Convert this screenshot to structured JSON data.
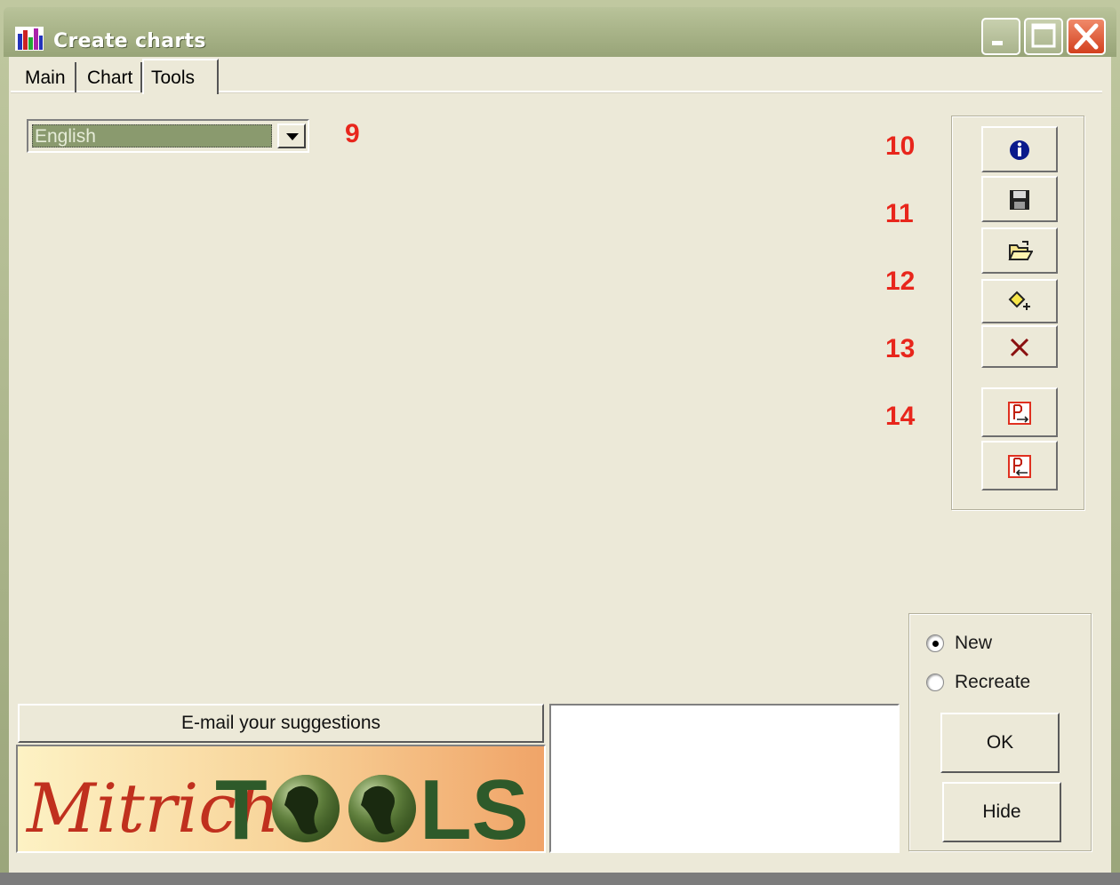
{
  "window": {
    "title": "Create charts",
    "icon": "bar-chart-icon"
  },
  "tabs": [
    {
      "label": "Main",
      "active": false
    },
    {
      "label": "Chart",
      "active": false
    },
    {
      "label": "Tools",
      "active": true
    }
  ],
  "language": {
    "selected": "English"
  },
  "markers": [
    "9",
    "10",
    "11",
    "12",
    "13",
    "14"
  ],
  "toolbar": {
    "buttons": [
      {
        "name": "info-button",
        "icon": "info-icon"
      },
      {
        "name": "save-button",
        "icon": "save-icon"
      },
      {
        "name": "open-button",
        "icon": "folder-open-icon"
      },
      {
        "name": "clear-format-button",
        "icon": "eraser-icon"
      },
      {
        "name": "delete-button",
        "icon": "delete-x-icon"
      },
      {
        "name": "export-button",
        "icon": "export-icon"
      },
      {
        "name": "import-button",
        "icon": "import-icon"
      }
    ]
  },
  "mode": {
    "options": [
      {
        "label": "New",
        "checked": true
      },
      {
        "label": "Recreate",
        "checked": false
      }
    ]
  },
  "actions": {
    "ok": "OK",
    "hide": "Hide"
  },
  "email": {
    "label": "E-mail your suggestions"
  },
  "logo": {
    "part1": "Mitrich",
    "part2_a": "T",
    "part2_b": "LS"
  },
  "colors": {
    "marker": "#e8261c",
    "titlebar": "#aab58a",
    "client_bg": "#ece9d8"
  }
}
